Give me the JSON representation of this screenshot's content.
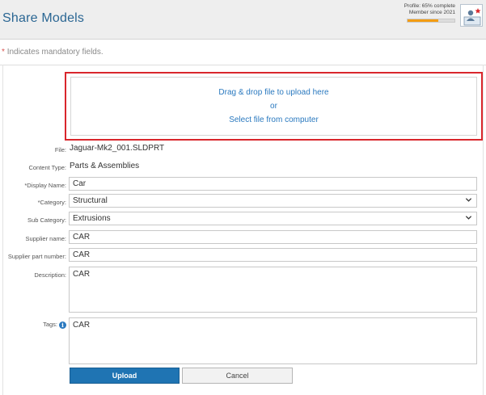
{
  "header": {
    "title": "Share Models",
    "profile_status": "Profile: 65% complete",
    "member_since": "Member since 2021",
    "profile_progress": 0.65,
    "accent_color": "#f39c12"
  },
  "form": {
    "mandatory_star": "*",
    "mandatory_note": "Indicates mandatory fields.",
    "dropzone": {
      "drag_text": "Drag & drop file to upload here",
      "or_text": "or",
      "select_text": "Select file from computer"
    },
    "file": {
      "label": "File:",
      "value": "Jaguar-Mk2_001.SLDPRT"
    },
    "content_type": {
      "label": "Content Type:",
      "value": "Parts & Assemblies"
    },
    "display_name": {
      "label": "*Display Name:",
      "value": "Car"
    },
    "category": {
      "label": "*Category:",
      "value": "Structural"
    },
    "sub_category": {
      "label": "Sub Category:",
      "value": "Extrusions"
    },
    "supplier_name": {
      "label": "Supplier name:",
      "value": "CAR"
    },
    "supplier_part_number": {
      "label": "Supplier part number:",
      "value": "CAR"
    },
    "description": {
      "label": "Description:",
      "value": "CAR"
    },
    "tags": {
      "label": "Tags:",
      "info_icon": "info-icon",
      "value": "CAR"
    }
  },
  "actions": {
    "upload_label": "Upload",
    "cancel_label": "Cancel",
    "primary_color": "#1f74b3"
  }
}
